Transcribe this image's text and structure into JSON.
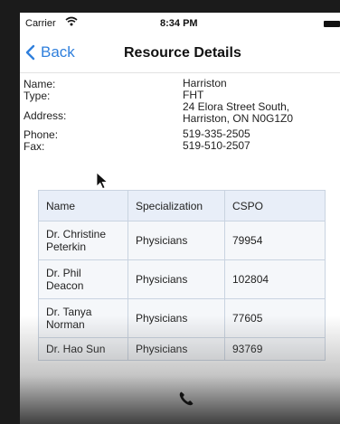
{
  "status_bar": {
    "carrier": "Carrier",
    "time": "8:34 PM"
  },
  "nav": {
    "back_label": "Back",
    "title": "Resource Details"
  },
  "details": {
    "name_label": "Name:",
    "name_value": "Harriston",
    "type_label": "Type:",
    "type_value": "FHT",
    "address_label": "Address:",
    "address_line1": "24 Elora Street South,",
    "address_line2": "Harriston, ON N0G1Z0",
    "phone_label": "Phone:",
    "phone_value": "519-335-2505",
    "fax_label": "Fax:",
    "fax_value": "519-510-2507"
  },
  "table": {
    "headers": [
      "Name",
      "Specialization",
      "CSPO"
    ],
    "rows": [
      {
        "name_line1": "Dr. Christine",
        "name_line2": "Peterkin",
        "specialization": "Physicians",
        "cspo": "79954"
      },
      {
        "name_line1": "Dr. Phil",
        "name_line2": "Deacon",
        "specialization": "Physicians",
        "cspo": "102804"
      },
      {
        "name_line1": "Dr. Tanya",
        "name_line2": "Norman",
        "specialization": "Physicians",
        "cspo": "77605"
      },
      {
        "name_line1": "Dr. Hao Sun",
        "name_line2": "",
        "specialization": "Physicians",
        "cspo": "93769"
      }
    ]
  },
  "icons": [
    "wifi-icon",
    "battery-icon",
    "chevron-left-icon",
    "mouse-cursor-icon",
    "phone-icon"
  ],
  "colors": {
    "accent": "#2f7fdc",
    "table_header_bg": "#e8eef8"
  }
}
